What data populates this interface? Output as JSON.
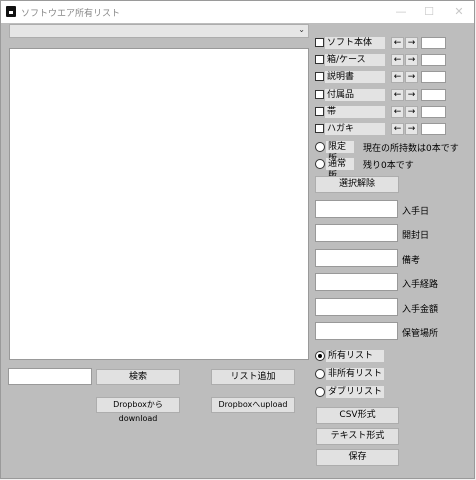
{
  "window": {
    "title": "ソフトウエア所有リスト",
    "minimize": "—",
    "maximize": "☐",
    "close": "✕"
  },
  "combo": {
    "value": "",
    "arrow": "⌄"
  },
  "search": {
    "input_value": "",
    "button": "検索"
  },
  "buttons": {
    "list_add": "リスト追加",
    "dropbox_download": "Dropboxからdownload",
    "dropbox_upload": "Dropboxへupload",
    "clear_selection": "選択解除",
    "csv_format": "CSV形式",
    "text_format": "テキスト形式",
    "save": "保存"
  },
  "items": [
    {
      "label": "ソフト本体",
      "left": "←",
      "right": "→",
      "value": ""
    },
    {
      "label": "箱/ケース",
      "left": "←",
      "right": "→",
      "value": ""
    },
    {
      "label": "説明書",
      "left": "←",
      "right": "→",
      "value": ""
    },
    {
      "label": "付属品",
      "left": "←",
      "right": "→",
      "value": ""
    },
    {
      "label": "帯",
      "left": "←",
      "right": "→",
      "value": ""
    },
    {
      "label": "ハガキ",
      "left": "←",
      "right": "→",
      "value": ""
    }
  ],
  "edition": {
    "limited": "限定版",
    "normal": "通常版",
    "owned_text": "現在の所持数は0本です",
    "remaining_text": "残り0本です"
  },
  "fields": [
    {
      "label": "入手日",
      "value": ""
    },
    {
      "label": "開封日",
      "value": ""
    },
    {
      "label": "備考",
      "value": ""
    },
    {
      "label": "入手経路",
      "value": ""
    },
    {
      "label": "入手金額",
      "value": ""
    },
    {
      "label": "保管場所",
      "value": ""
    }
  ],
  "list_type": {
    "owned": "所有リスト",
    "not_owned": "非所有リスト",
    "double": "ダブリリスト",
    "selected": "owned"
  }
}
